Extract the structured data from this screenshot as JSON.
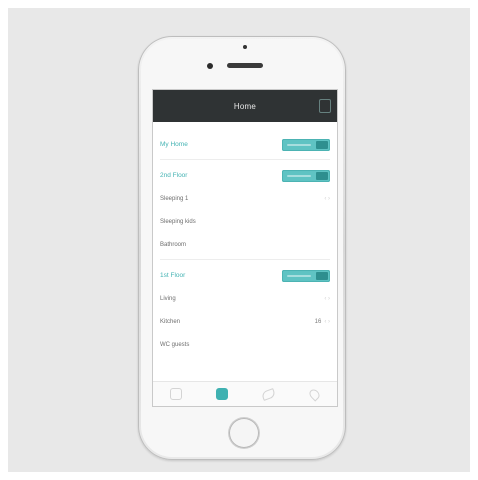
{
  "app": {
    "title": "Home"
  },
  "sections": [
    {
      "label": "My Home",
      "toggle": "on",
      "rooms": []
    },
    {
      "label": "2nd Floor",
      "toggle": "on",
      "rooms": [
        {
          "label": "Sleeping 1",
          "value": "",
          "chevron": "‹ ›"
        },
        {
          "label": "Sleeping kids",
          "value": "",
          "chevron": ""
        },
        {
          "label": "Bathroom",
          "value": "",
          "chevron": ""
        }
      ]
    },
    {
      "label": "1st Floor",
      "toggle": "on",
      "rooms": [
        {
          "label": "Living",
          "value": "",
          "chevron": "‹ ›"
        },
        {
          "label": "Kitchen",
          "value": "16",
          "chevron": "‹ ›"
        },
        {
          "label": "WC guests",
          "value": "",
          "chevron": ""
        }
      ]
    }
  ],
  "tabs": [
    {
      "icon": "home-tab-icon",
      "active": false
    },
    {
      "icon": "rooms-tab-icon",
      "active": true
    },
    {
      "icon": "leaf-tab-icon",
      "active": false
    },
    {
      "icon": "drop-tab-icon",
      "active": false
    }
  ],
  "colors": {
    "accent": "#44b3b3",
    "topbar": "#2f3334",
    "toggle_on": "#5fc3c3"
  }
}
